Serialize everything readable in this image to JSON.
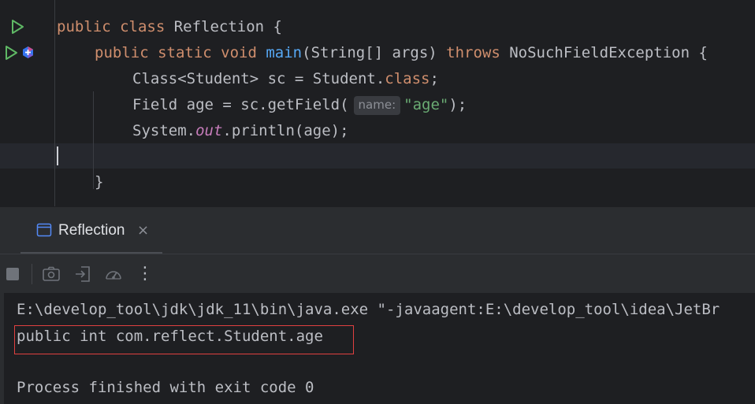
{
  "editor": {
    "lines": [
      {
        "tokens": [
          {
            "t": "public ",
            "c": "kw"
          },
          {
            "t": "class ",
            "c": "kw"
          },
          {
            "t": "Reflection {",
            "c": "txt"
          }
        ]
      },
      {
        "tokens": [
          {
            "t": "public ",
            "c": "kw"
          },
          {
            "t": "static ",
            "c": "kw"
          },
          {
            "t": "void ",
            "c": "kw"
          },
          {
            "t": "main",
            "c": "fn"
          },
          {
            "t": "(String[] args) ",
            "c": "txt"
          },
          {
            "t": "throws ",
            "c": "kw"
          },
          {
            "t": "NoSuchFieldException {",
            "c": "txt"
          }
        ]
      },
      {
        "tokens": [
          {
            "t": "Class<Student> sc = Student.",
            "c": "txt"
          },
          {
            "t": "class",
            "c": "kw"
          },
          {
            "t": ";",
            "c": "txt"
          }
        ]
      },
      {
        "tokens": [
          {
            "t": "Field age = sc.getField(",
            "c": "txt"
          },
          {
            "t": "name:",
            "c": "hint"
          },
          {
            "t": "\"age\"",
            "c": "str"
          },
          {
            "t": ");",
            "c": "txt"
          }
        ]
      },
      {
        "tokens": [
          {
            "t": "System.",
            "c": "txt"
          },
          {
            "t": "out",
            "c": "it"
          },
          {
            "t": ".println(age);",
            "c": "txt"
          }
        ]
      },
      {
        "tokens": []
      },
      {
        "tokens": [
          {
            "t": "}",
            "c": "txt"
          }
        ]
      }
    ],
    "gutter_icons": [
      "run-class-icon",
      "run-main-icon",
      "implements-icon"
    ]
  },
  "run_panel": {
    "tab_label": "Reflection",
    "tab_close": "×",
    "toolbar": [
      "stop-icon",
      "screenshot-icon",
      "restore-layout-icon",
      "profiler-icon",
      "more-options-icon"
    ],
    "more_glyph": "⋮"
  },
  "console": {
    "command": "E:\\develop_tool\\jdk\\jdk_11\\bin\\java.exe \"-javaagent:E:\\develop_tool\\idea\\JetBr",
    "output": "public int com.reflect.Student.age",
    "exit": "Process finished with exit code 0"
  },
  "colors": {
    "background": "#1e1f22",
    "keyword": "#cf8e6d",
    "function": "#56a8f5",
    "string": "#6aab73",
    "static_field": "#c77dbb",
    "run_icon": "#5fb865",
    "highlight_border": "#e04040"
  }
}
